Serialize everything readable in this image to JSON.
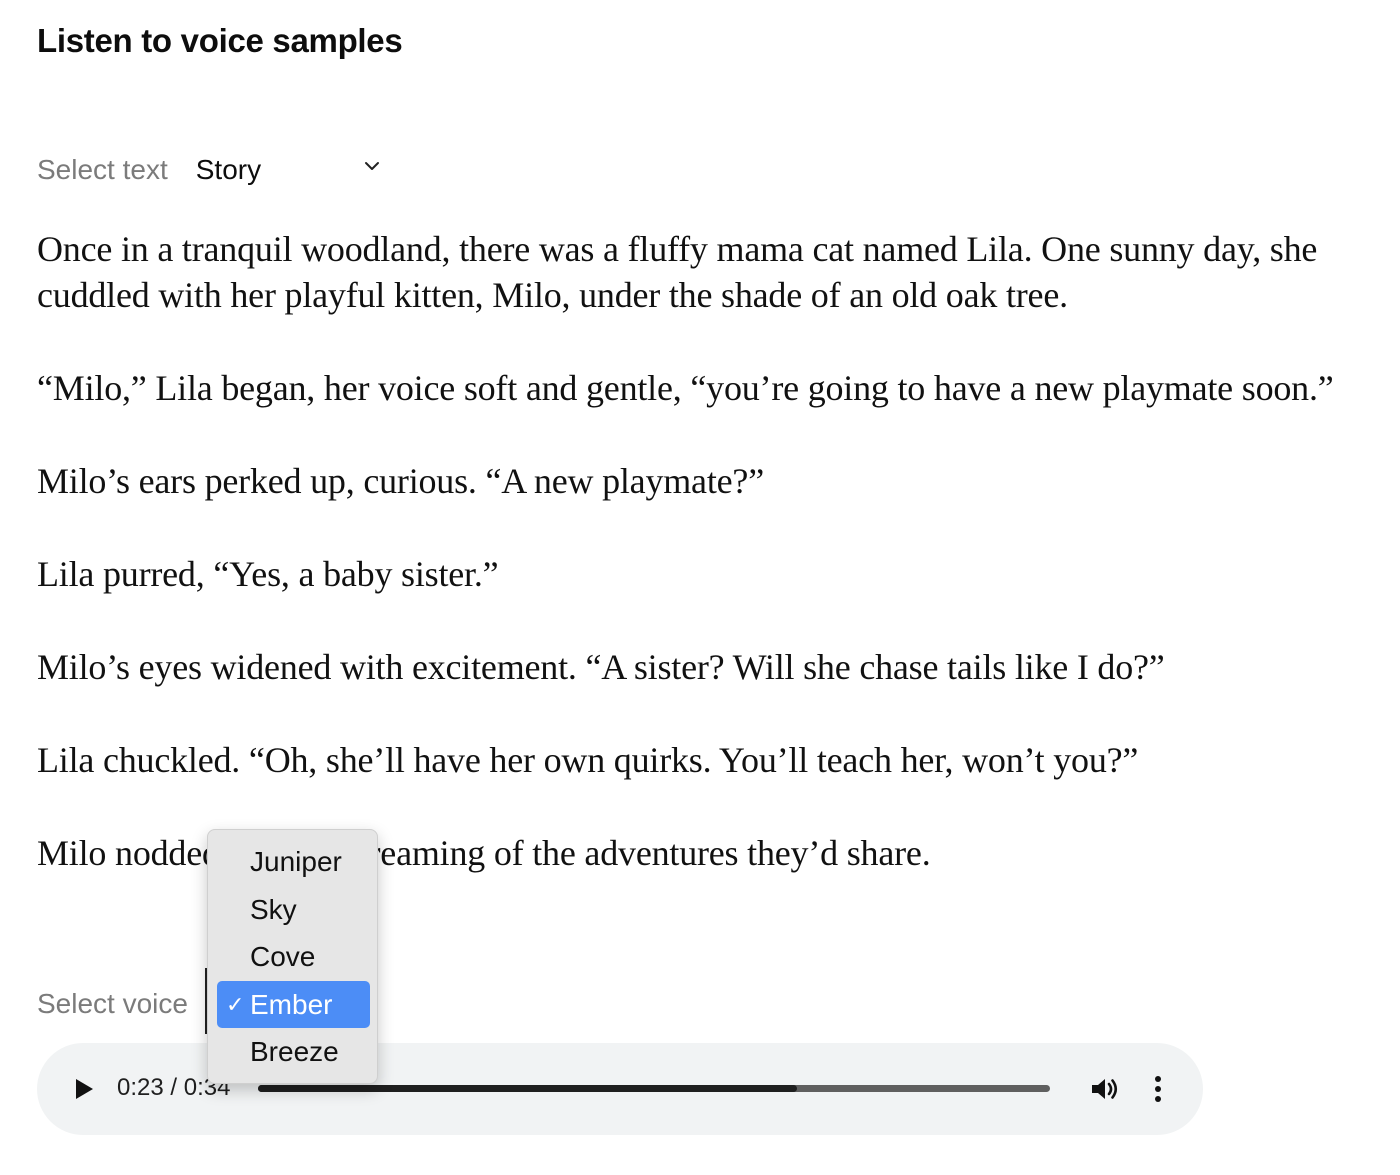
{
  "heading": "Listen to voice samples",
  "text_select": {
    "label": "Select text",
    "value": "Story"
  },
  "story": [
    "Once in a tranquil woodland, there was a fluffy mama cat named Lila. One sunny day, she cuddled with her playful kitten, Milo, under the shade of an old oak tree.",
    "“Milo,” Lila began, her voice soft and gentle, “you’re going to have a new playmate soon.”",
    "Milo’s ears perked up, curious. “A new playmate?”",
    "Lila purred, “Yes, a baby sister.”",
    "Milo’s eyes widened with excitement. “A sister? Will she chase tails like I do?”",
    "Lila chuckled. “Oh, she’ll have her own quirks. You’ll teach her, won’t you?”",
    "Milo nodded, already dreaming of the adventures they’d share."
  ],
  "voice_select": {
    "label": "Select voice",
    "options": [
      "Juniper",
      "Sky",
      "Cove",
      "Ember",
      "Breeze"
    ],
    "selected": "Ember",
    "check_glyph": "✓",
    "highlight_color": "#4c8df6"
  },
  "player": {
    "time": "0:23 / 0:34",
    "progress": 0.68,
    "play_icon": "play-icon",
    "volume_icon": "volume-icon",
    "more_icon": "more-vertical-icon"
  }
}
